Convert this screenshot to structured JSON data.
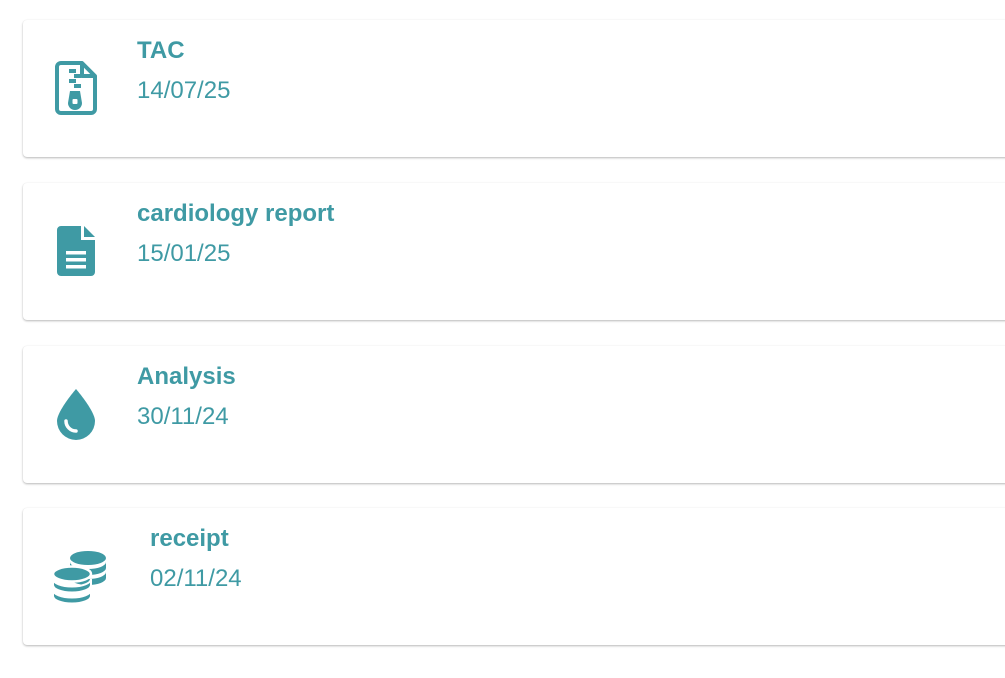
{
  "accent_color": "#3f9aa4",
  "documents": [
    {
      "title": "TAC",
      "date": "14/07/25",
      "icon": "file-zipper-icon"
    },
    {
      "title": "cardiology report",
      "date": "15/01/25",
      "icon": "file-lines-icon"
    },
    {
      "title": "Analysis",
      "date": "30/11/24",
      "icon": "blood-drop-icon"
    },
    {
      "title": "receipt",
      "date": "02/11/24",
      "icon": "coins-icon"
    }
  ]
}
